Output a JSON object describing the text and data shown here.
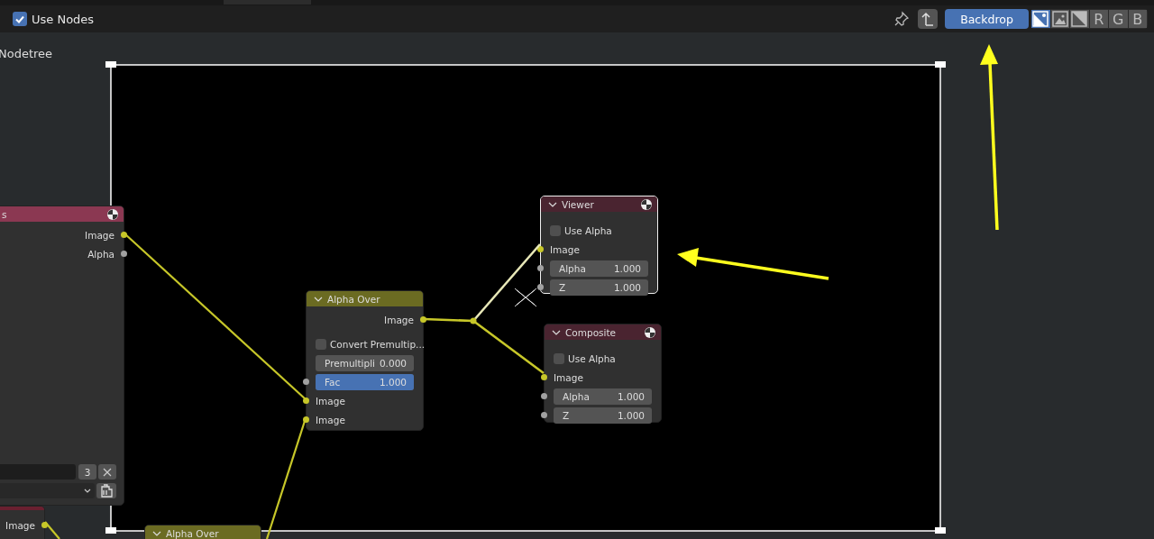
{
  "toolbar": {
    "use_nodes": {
      "label": "Use Nodes",
      "checked": true
    },
    "backdrop": {
      "label": "Backdrop",
      "on": true
    },
    "channels": [
      {
        "kind": "color-alpha",
        "selected": true
      },
      {
        "kind": "color",
        "selected": false
      },
      {
        "kind": "alpha",
        "selected": false
      },
      {
        "kind": "letter",
        "label": "R",
        "selected": false
      },
      {
        "kind": "letter",
        "label": "G",
        "selected": false
      },
      {
        "kind": "letter",
        "label": "B",
        "selected": false
      }
    ]
  },
  "canvas": {
    "tree_label": "Nodetree"
  },
  "nodes": [
    {
      "color": "#6a2030",
      "selected": false,
      "items": [
        {
          "kind": "output",
          "label": "Image",
          "color": "#c7c729"
        }
      ]
    },
    {
      "title": "s",
      "color": "#8b3852",
      "selected": false,
      "render_icon": true,
      "items": [
        {
          "kind": "output",
          "label": "Image",
          "color": "#c7c729"
        },
        {
          "kind": "output",
          "label": "Alpha",
          "color": "#a1a1a1"
        },
        {
          "kind": "users-field",
          "value": "3"
        },
        {
          "kind": "dropdown"
        }
      ]
    },
    {
      "title": "Alpha Over",
      "color": "#6b6b22",
      "expanded": true,
      "selected": false,
      "items": [
        {
          "kind": "output",
          "label": "Image",
          "color": "#c7c729"
        },
        {
          "kind": "checkbox",
          "label": "Convert Premultip...",
          "checked": false
        },
        {
          "kind": "value",
          "label": "Premultipli",
          "value": "0.000"
        },
        {
          "kind": "slider",
          "label": "Fac",
          "value": "1.000",
          "level": 1,
          "color": "#a1a1a1"
        },
        {
          "kind": "input",
          "label": "Image",
          "color": "#c7c729"
        },
        {
          "kind": "input",
          "label": "Image",
          "color": "#c7c729"
        }
      ]
    },
    {
      "title": "Viewer",
      "color": "#4a2430",
      "expanded": true,
      "selected": true,
      "render_icon": true,
      "items": [
        {
          "kind": "checkbox",
          "label": "Use Alpha",
          "checked": false
        },
        {
          "kind": "input",
          "label": "Image",
          "color": "#c7c729"
        },
        {
          "kind": "value",
          "label": "Alpha",
          "value": "1.000",
          "color": "#a1a1a1"
        },
        {
          "kind": "value",
          "label": "Z",
          "value": "1.000",
          "color": "#a1a1a1"
        }
      ]
    },
    {
      "title": "Composite",
      "color": "#4a2430",
      "expanded": true,
      "selected": false,
      "render_icon": true,
      "items": [
        {
          "kind": "checkbox",
          "label": "Use Alpha",
          "checked": false
        },
        {
          "kind": "input",
          "label": "Image",
          "color": "#c7c729"
        },
        {
          "kind": "value",
          "label": "Alpha",
          "value": "1.000",
          "color": "#a1a1a1"
        },
        {
          "kind": "value",
          "label": "Z",
          "value": "1.000",
          "color": "#a1a1a1"
        }
      ]
    },
    {
      "title": "Alpha Over",
      "color": "#6b6b22",
      "expanded": true,
      "selected": false
    }
  ]
}
